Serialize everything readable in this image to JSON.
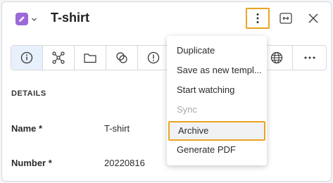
{
  "header": {
    "title": "T-shirt",
    "type_icon": "pencil-icon",
    "accent_color": "#9b6ad8",
    "highlight_color": "#e9a425"
  },
  "toolbar": {
    "icons": [
      "info-icon",
      "relations-icon",
      "folder-icon",
      "link-icon",
      "alert-icon",
      "globe-icon",
      "more-horizontal-icon"
    ]
  },
  "details": {
    "section_title": "DETAILS",
    "fields": [
      {
        "label": "Name *",
        "value": "T-shirt"
      },
      {
        "label": "Number *",
        "value": "20220816"
      }
    ]
  },
  "menu": {
    "items": [
      {
        "label": "Duplicate",
        "disabled": false
      },
      {
        "label": "Save as new templ...",
        "disabled": false
      },
      {
        "label": "Start watching",
        "disabled": false
      },
      {
        "label": "Sync",
        "disabled": true
      },
      {
        "label": "Archive",
        "disabled": false,
        "highlighted": true
      },
      {
        "label": "Generate PDF",
        "disabled": false
      }
    ]
  }
}
